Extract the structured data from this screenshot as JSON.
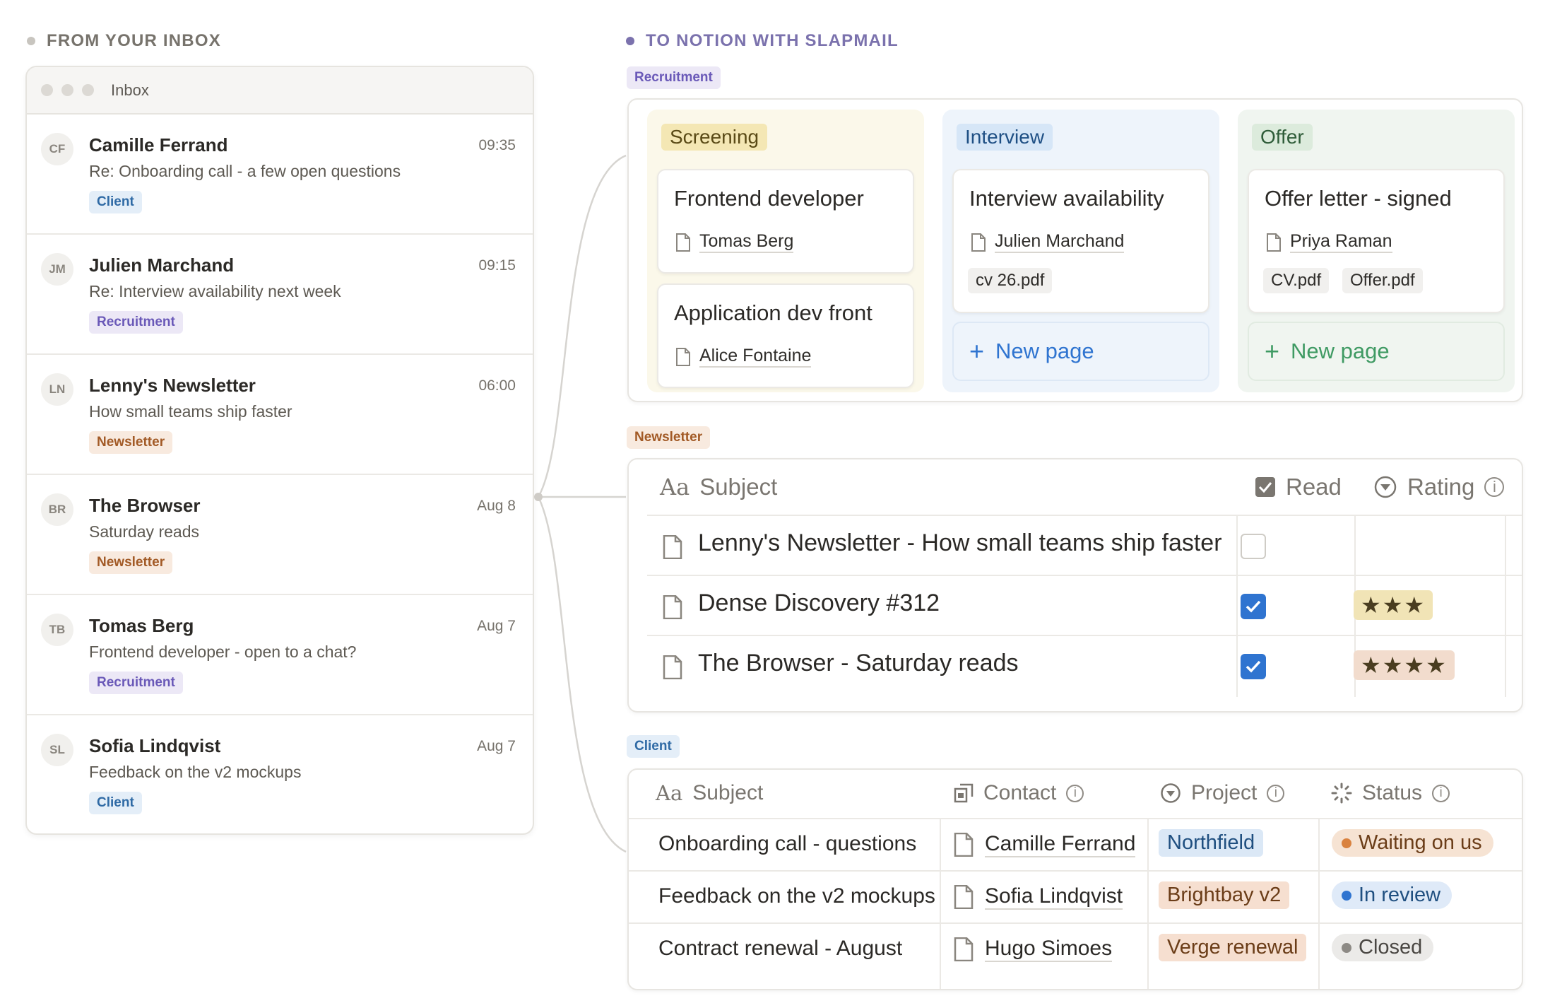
{
  "headers": {
    "left": "FROM YOUR INBOX",
    "right": "TO NOTION WITH SLAPMAIL"
  },
  "inbox": {
    "title": "Inbox",
    "mails": [
      {
        "initials": "CF",
        "from": "Camille Ferrand",
        "time": "09:35",
        "subject": "Re: Onboarding call - a few open questions",
        "tag": "Client"
      },
      {
        "initials": "JM",
        "from": "Julien Marchand",
        "time": "09:15",
        "subject": "Re: Interview availability next week",
        "tag": "Recruitment"
      },
      {
        "initials": "LN",
        "from": "Lenny's Newsletter",
        "time": "06:00",
        "subject": "How small teams ship faster",
        "tag": "Newsletter"
      },
      {
        "initials": "BR",
        "from": "The Browser",
        "time": "Aug 8",
        "subject": "Saturday reads",
        "tag": "Newsletter"
      },
      {
        "initials": "TB",
        "from": "Tomas Berg",
        "time": "Aug 7",
        "subject": "Frontend developer - open to a chat?",
        "tag": "Recruitment"
      },
      {
        "initials": "SL",
        "from": "Sofia Lindqvist",
        "time": "Aug 7",
        "subject": "Feedback on the v2 mockups",
        "tag": "Client"
      }
    ]
  },
  "recruitment": {
    "label": "Recruitment",
    "columns": [
      {
        "name": "Screening",
        "cards": [
          {
            "title": "Frontend developer",
            "person": "Tomas Berg",
            "files": []
          },
          {
            "title": "Application dev front",
            "person": "Alice Fontaine",
            "files": []
          }
        ]
      },
      {
        "name": "Interview",
        "cards": [
          {
            "title": "Interview availability",
            "person": "Julien Marchand",
            "files": [
              "cv 26.pdf"
            ]
          }
        ],
        "new_page": "New page"
      },
      {
        "name": "Offer",
        "cards": [
          {
            "title": "Offer letter - signed",
            "person": "Priya Raman",
            "files": [
              "CV.pdf",
              "Offer.pdf"
            ]
          }
        ],
        "new_page": "New page"
      }
    ]
  },
  "newsletter": {
    "label": "Newsletter",
    "headers": {
      "subject": "Subject",
      "read": "Read",
      "rating": "Rating"
    },
    "rows": [
      {
        "subject": "Lenny's Newsletter - How small teams ship faster",
        "read": false,
        "rating": ""
      },
      {
        "subject": "Dense Discovery #312",
        "read": true,
        "rating": "★★★"
      },
      {
        "subject": "The Browser - Saturday reads",
        "read": true,
        "rating": "★★★★"
      }
    ]
  },
  "client": {
    "label": "Client",
    "headers": {
      "subject": "Subject",
      "contact": "Contact",
      "project": "Project",
      "status": "Status"
    },
    "rows": [
      {
        "subject": "Onboarding call - questions",
        "contact": "Camille Ferrand",
        "project": "Northfield",
        "status": "Waiting on us"
      },
      {
        "subject": "Feedback on the v2 mockups",
        "contact": "Sofia Lindqvist",
        "project": "Brightbay v2",
        "status": "In review"
      },
      {
        "subject": "Contract renewal - August",
        "contact": "Hugo Simoes",
        "project": "Verge renewal",
        "status": "Closed"
      }
    ]
  },
  "colors": {
    "screening_bg": "#fbf8ea",
    "screening_tag": "#f4e7b4",
    "interview_bg": "#eef4fb",
    "interview_tag": "#d6e6f7",
    "offer_bg": "#f0f5f0",
    "offer_tag": "#dcebdc",
    "interview_accent": "#2f74d0",
    "offer_accent": "#3f9a63",
    "checkbox_on": "#2f74d0",
    "status_waiting": "#d9823f",
    "status_review": "#2f74d0",
    "status_closed": "#8d8a85"
  }
}
